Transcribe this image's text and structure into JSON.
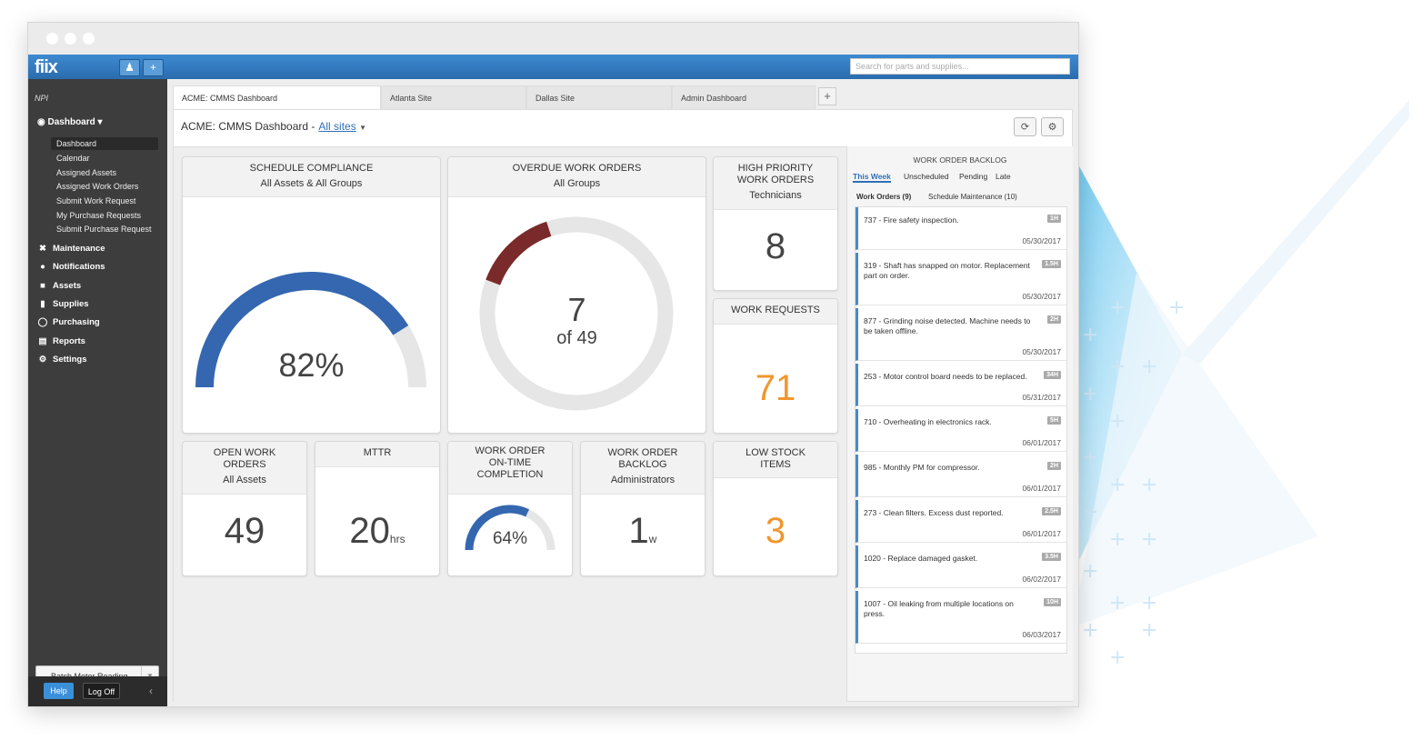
{
  "app": {
    "logo": "fiix",
    "search_placeholder": "Search for parts and supplies..."
  },
  "sidebar": {
    "org": "NPI",
    "dashboard_label": "Dashboard",
    "dashboard_items": [
      "Dashboard",
      "Calendar",
      "Assigned Assets",
      "Assigned Work Orders",
      "Submit Work Request",
      "My Purchase Requests",
      "Submit Purchase Request"
    ],
    "nav": [
      {
        "label": "Maintenance",
        "icon": "wrench-icon"
      },
      {
        "label": "Notifications",
        "icon": "chat-bubble-icon"
      },
      {
        "label": "Assets",
        "icon": "assets-icon"
      },
      {
        "label": "Supplies",
        "icon": "truck-icon"
      },
      {
        "label": "Purchasing",
        "icon": "cart-icon"
      },
      {
        "label": "Reports",
        "icon": "chart-icon"
      },
      {
        "label": "Settings",
        "icon": "gear-icon"
      }
    ],
    "batch_label": "Batch Meter Reading",
    "help_label": "Help",
    "logoff_label": "Log Off"
  },
  "tabs": [
    "ACME: CMMS Dashboard",
    "Atlanta Site",
    "Dallas Site",
    "Admin Dashboard"
  ],
  "dashboard": {
    "title": "ACME: CMMS Dashboard -",
    "site_link": "All sites"
  },
  "cards": {
    "schedule_compliance": {
      "title": "SCHEDULE COMPLIANCE",
      "subtitle": "All Assets & All Groups",
      "value": "82%",
      "fraction": 0.82
    },
    "overdue": {
      "title": "OVERDUE WORK ORDERS",
      "subtitle": "All Groups",
      "value": "7",
      "of_text": "of 49",
      "fraction": 0.143
    },
    "high_priority": {
      "title1": "HIGH PRIORITY",
      "title2": "WORK ORDERS",
      "subtitle": "Technicians",
      "value": "8"
    },
    "work_requests": {
      "title": "WORK REQUESTS",
      "value": "71"
    },
    "open_work_orders": {
      "title1": "OPEN WORK",
      "title2": "ORDERS",
      "subtitle": "All Assets",
      "value": "49"
    },
    "mttr": {
      "title": "MTTR",
      "value": "20",
      "unit": "hrs"
    },
    "on_time": {
      "title1": "WORK ORDER",
      "title2": "ON-TIME",
      "title3": "COMPLETION",
      "value": "64%",
      "fraction": 0.64
    },
    "backlog_card": {
      "title1": "WORK ORDER",
      "title2": "BACKLOG",
      "subtitle": "Administrators",
      "value": "1",
      "unit": "w"
    },
    "low_stock": {
      "title1": "LOW STOCK",
      "title2": "ITEMS",
      "value": "3"
    }
  },
  "backlog": {
    "title": "WORK ORDER BACKLOG",
    "filters": [
      "This Week",
      "Unscheduled",
      "Pending",
      "Late"
    ],
    "subtabs": [
      "Work Orders (9)",
      "Schedule Maintenance (10)"
    ],
    "items": [
      {
        "text": "737 - Fire safety inspection.",
        "badge": "1H",
        "date": "05/30/2017"
      },
      {
        "text": "319 - Shaft has snapped on motor. Replacement part on order.",
        "badge": "1.5H",
        "date": "05/30/2017"
      },
      {
        "text": "877 - Grinding noise detected. Machine needs to be taken offline.",
        "badge": "2H",
        "date": "05/30/2017"
      },
      {
        "text": "253 - Motor control board needs to be replaced.",
        "badge": "34H",
        "date": "05/31/2017"
      },
      {
        "text": "710 - Overheating in electronics rack.",
        "badge": "5H",
        "date": "06/01/2017"
      },
      {
        "text": "985 - Monthly PM for compressor.",
        "badge": "2H",
        "date": "06/01/2017"
      },
      {
        "text": "273 - Clean filters. Excess dust reported.",
        "badge": "2.5H",
        "date": "06/01/2017"
      },
      {
        "text": "1020 - Replace damaged gasket.",
        "badge": "3.5H",
        "date": "06/02/2017"
      },
      {
        "text": "1007 - Oil leaking from multiple locations on press.",
        "badge": "10H",
        "date": "06/03/2017"
      }
    ]
  },
  "colors": {
    "accent_blue": "#3467b0",
    "overdue_red": "#7a2a2a",
    "track_gray": "#e6e6e6",
    "orange": "#f0962e"
  }
}
